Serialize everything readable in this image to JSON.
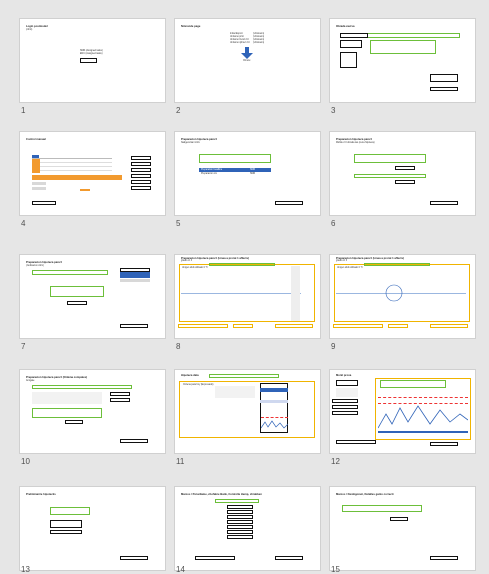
{
  "slides": [
    {
      "number": "1",
      "title": "Login postmodel",
      "subtitle": "(citrix)",
      "lines": [
        "SMR (Assigned tasks)",
        "ENC (Assigned tasks)"
      ],
      "box": ""
    },
    {
      "number": "2",
      "title": "Ninnonde page",
      "lines": [
        "Initial Export",
        "Unitarno print",
        "Unitarno Izvod 2.0",
        "Unitarno njihovi 2.0"
      ],
      "values": [
        "(Unknown)",
        "(Unknown)",
        "(Unknown)",
        "(Unknown)"
      ],
      "button": "Obnovi"
    },
    {
      "number": "3",
      "title": "Obrada zavrsa"
    },
    {
      "number": "4",
      "title": "Control manual"
    },
    {
      "number": "5",
      "title": "Preparacion hipoteca para 0",
      "subtitle": "Nadgenvitani citrix",
      "table": [
        "Preparation headline",
        "SMR",
        "Preparacion ctx",
        "SMR"
      ]
    },
    {
      "number": "6",
      "title": "Preparacion hipoteca para 0",
      "subtitle": "Mobile 2.0 obrada tas (cena hipoteca)"
    },
    {
      "number": "7",
      "title": "Preparacion hipoteca para 0",
      "subtitle": "(Judicacion citrix)"
    },
    {
      "number": "8",
      "title": "Preparacion hipoteca para 0 (Linea a prorat 1 affects)",
      "subtitle": "grado ori 3",
      "chart": "Unigen slidi utilizado 0 Tl"
    },
    {
      "number": "9",
      "title": "Preparacion hipoteca para 0 (Linea a prorat 1 affects)",
      "subtitle": "grado ori 3",
      "chart": "Unigen slidi utilizado 0 Tl"
    },
    {
      "number": "10",
      "title": "Preparacion hipoteca para 0 (Ordena compales)",
      "subtitle": "Amigate"
    },
    {
      "number": "11",
      "title": "Hipoteca data",
      "subtitle": "Ordena para hoy (Expresado)"
    },
    {
      "number": "12",
      "title": "Monit prova"
    },
    {
      "number": "13",
      "title": "Preliminarrie hipoteciis"
    },
    {
      "number": "14",
      "title": "Marcos / Pensiliame, chofabre Bank, Controlle Hemp, chrabben"
    },
    {
      "number": "15",
      "title": "Marcos / Desbigoraci, Detalles ganto correcti"
    }
  ]
}
